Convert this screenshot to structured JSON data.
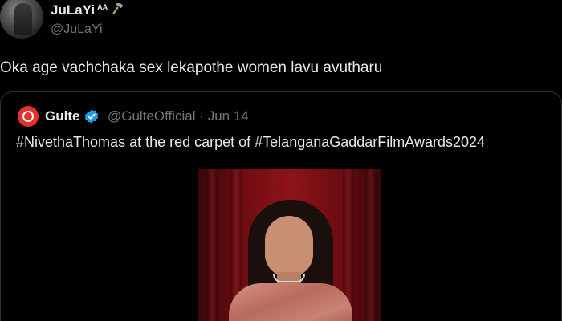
{
  "tweet": {
    "display_name": "JuLaYi",
    "name_suffix": "AA",
    "handle": "@JuLaYi____",
    "text": "Oka age vachchaka sex lekapothe women lavu avutharu"
  },
  "quoted_tweet": {
    "account_name": "Gulte",
    "handle": "@GulteOfficial",
    "separator": "·",
    "date": "Jun 14",
    "text": "#NivethaThomas at the red carpet of #TelanganaGaddarFilmAwards2024",
    "avatar_color": "#e5322d",
    "verified_color": "#1d9bf0"
  },
  "icons": {
    "name_emoji": "hammer-icon",
    "verified": "verified-badge-icon"
  },
  "colors": {
    "background": "#000000",
    "text_primary": "#e7e9ea",
    "text_secondary": "#71767b",
    "border": "#2f3336"
  }
}
